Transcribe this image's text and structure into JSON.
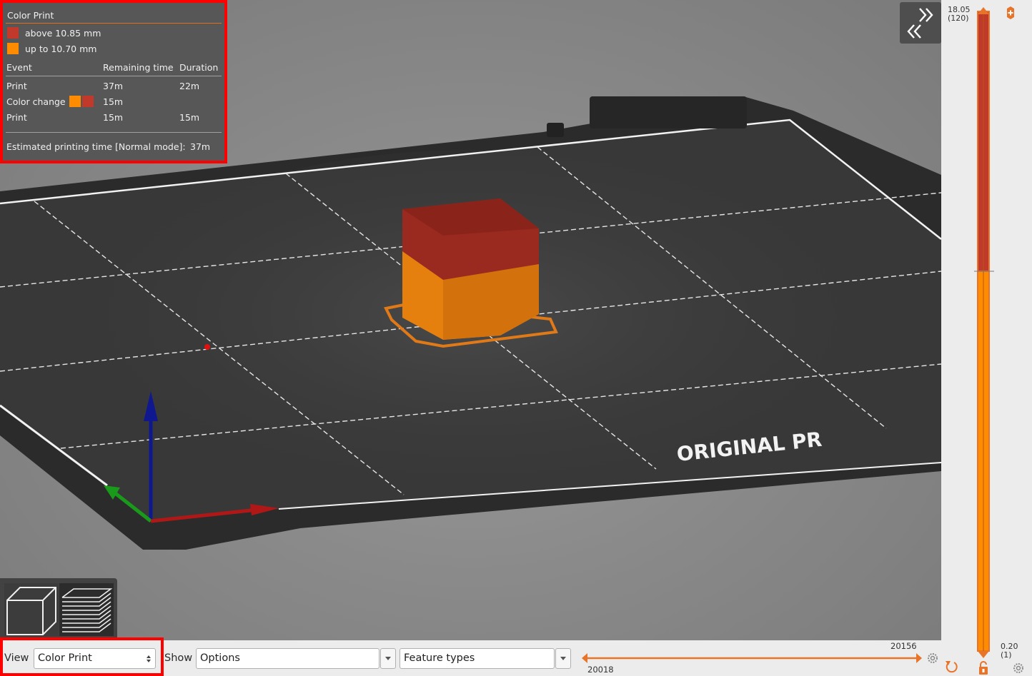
{
  "legend": {
    "title": "Color Print",
    "colors": [
      {
        "label": "above 10.85 mm",
        "color": "#c0392b"
      },
      {
        "label": "up to 10.70 mm",
        "color": "#ff8c00"
      }
    ],
    "columns": [
      "Event",
      "Remaining time",
      "Duration"
    ],
    "rows": [
      {
        "event": "Print",
        "remaining": "37m",
        "duration": "22m"
      },
      {
        "event": "Color change",
        "remaining": "15m",
        "duration": ""
      },
      {
        "event": "Print",
        "remaining": "15m",
        "duration": "15m"
      }
    ],
    "estimate_label": "Estimated printing time [Normal mode]:",
    "estimate_value": "37m"
  },
  "bed": {
    "brand_text": "ORIGINAL PR"
  },
  "vertical_slider": {
    "top_value": "18.05",
    "top_layer": "(120)",
    "bottom_value": "0.20",
    "bottom_layer": "(1)",
    "upper_color": "#c0392b",
    "lower_color": "#ff8c00"
  },
  "horizontal_slider": {
    "right_value": "20156",
    "left_value": "20018"
  },
  "bottom_bar": {
    "view_label": "View",
    "view_value": "Color Print",
    "show_label": "Show",
    "options_value": "Options",
    "feature_value": "Feature types"
  },
  "accent_color": "#e8742a",
  "highlight_color": "#ff0000"
}
